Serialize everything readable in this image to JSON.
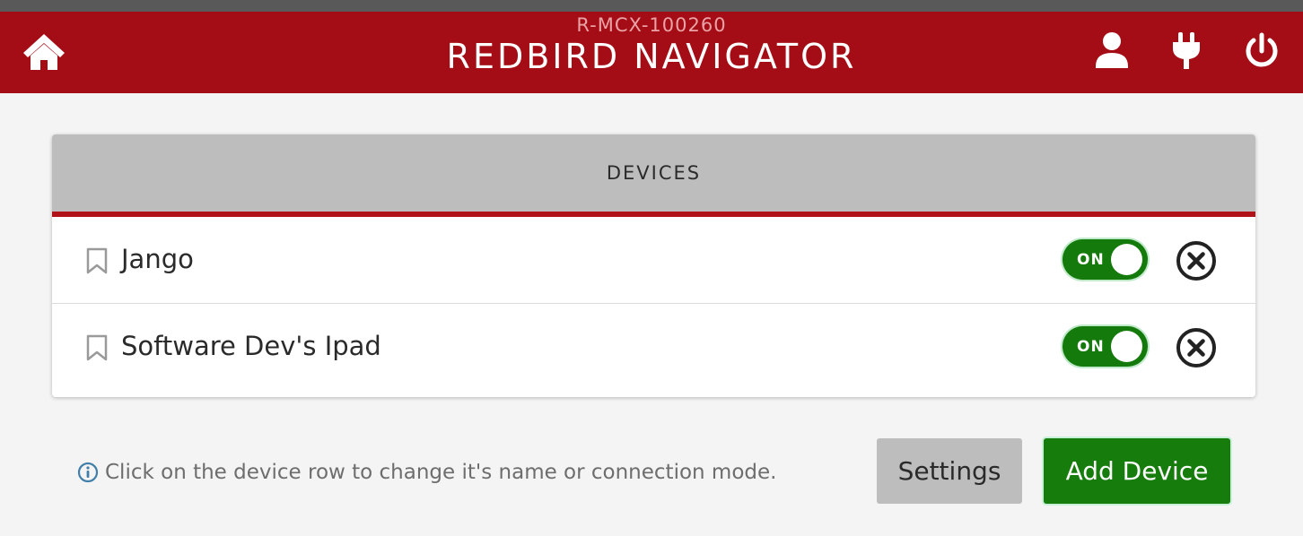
{
  "header": {
    "device_id": "R-MCX-100260",
    "title": "REDBIRD NAVIGATOR"
  },
  "card": {
    "title": "DEVICES"
  },
  "devices": [
    {
      "name": "Jango",
      "toggle_label": "ON"
    },
    {
      "name": "Software Dev's Ipad",
      "toggle_label": "ON"
    }
  ],
  "footer": {
    "hint": "Click on the device row to change it's name or connection mode.",
    "settings_label": "Settings",
    "add_device_label": "Add Device"
  },
  "colors": {
    "header_bg": "#a50d16",
    "toggle_on": "#137a0b",
    "add_button": "#167c0c"
  },
  "icons": [
    "home-icon",
    "user-icon",
    "plug-icon",
    "power-icon",
    "bookmark-icon",
    "close-circle-icon",
    "info-icon"
  ]
}
